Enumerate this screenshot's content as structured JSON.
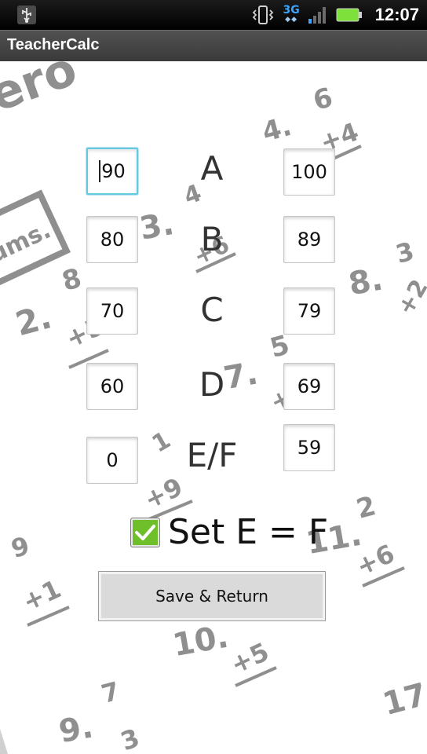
{
  "status_bar": {
    "time": "12:07",
    "network": "3G",
    "icons": [
      "usb-icon",
      "vibrate-icon",
      "3g-icon",
      "signal-icon",
      "battery-icon"
    ]
  },
  "app": {
    "title": "TeacherCalc"
  },
  "grades": [
    {
      "letter": "A",
      "min": "90",
      "max": "100"
    },
    {
      "letter": "B",
      "min": "80",
      "max": "89"
    },
    {
      "letter": "C",
      "min": "70",
      "max": "79"
    },
    {
      "letter": "D",
      "min": "60",
      "max": "69"
    },
    {
      "letter": "E/F",
      "min": "0",
      "max": "59"
    }
  ],
  "focused_field": "grades.0.min",
  "set_e_equals_f": {
    "label": "Set E = F",
    "checked": true
  },
  "save_button": {
    "label": "Save & Return"
  },
  "colors": {
    "focus_border": "#67c9e0",
    "checkbox_green": "#6fbf2a",
    "battery_green": "#7ee03a",
    "net_blue": "#3aa6ff"
  }
}
